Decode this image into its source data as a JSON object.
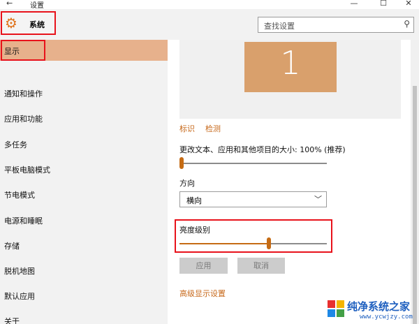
{
  "window": {
    "title": "设置",
    "back_glyph": "←",
    "min_glyph": "—",
    "max_glyph": "☐",
    "close_glyph": "✕"
  },
  "header": {
    "category_label": "系统",
    "search_placeholder": "查找设置"
  },
  "sidebar": {
    "items": [
      {
        "label": "显示"
      },
      {
        "label": "通知和操作"
      },
      {
        "label": "应用和功能"
      },
      {
        "label": "多任务"
      },
      {
        "label": "平板电脑模式"
      },
      {
        "label": "节电模式"
      },
      {
        "label": "电源和睡眠"
      },
      {
        "label": "存储"
      },
      {
        "label": "脱机地图"
      },
      {
        "label": "默认应用"
      },
      {
        "label": "关于"
      }
    ],
    "selected_index": 0
  },
  "display": {
    "monitor_number": "1",
    "identify_link": "标识",
    "detect_link": "检测",
    "scale_label": "更改文本、应用和其他项目的大小: 100% (推荐)",
    "scale_slider_value": 0.0,
    "orientation_label": "方向",
    "orientation_value": "横向",
    "brightness_label": "亮度级别",
    "brightness_value": 0.61,
    "apply_button": "应用",
    "cancel_button": "取消",
    "advanced_link": "高级显示设置"
  },
  "watermark": {
    "text": "纯净系统之家",
    "sub": "www.ycwjzy.com"
  },
  "colors": {
    "accent": "#c56b14",
    "selected_bg": "#e7b18c",
    "highlight_box": "#e8121b",
    "link": "#c7691b"
  }
}
